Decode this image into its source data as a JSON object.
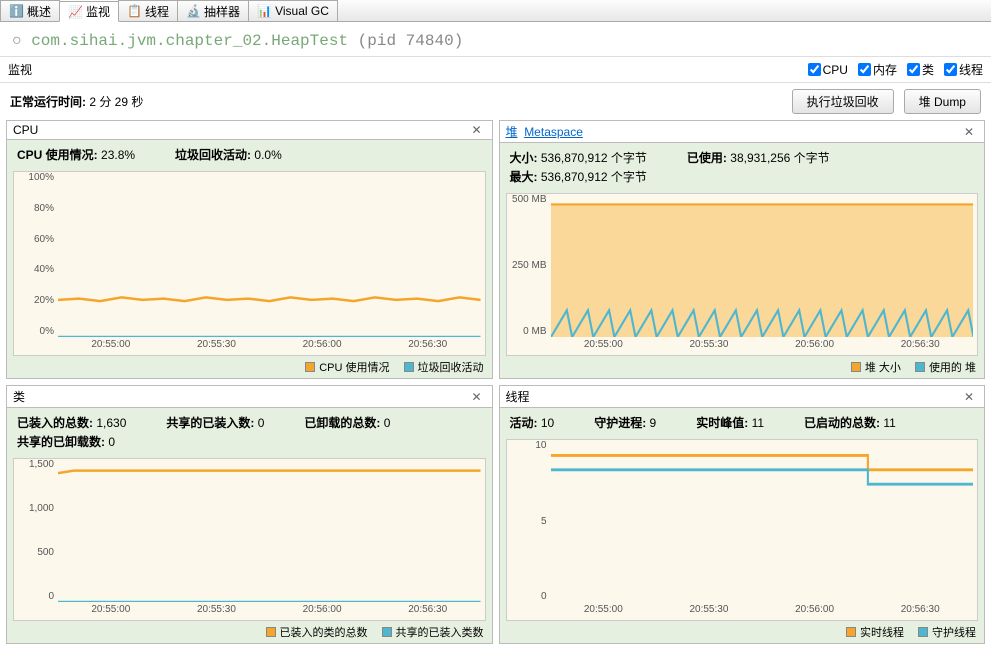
{
  "tabs": [
    "概述",
    "监视",
    "线程",
    "抽样器",
    "Visual GC"
  ],
  "active_tab": 1,
  "title_main": "com.sihai.jvm.chapter_02.HeapTest",
  "title_pid": "(pid 74840)",
  "sub_label": "监视",
  "checks": {
    "cpu": "CPU",
    "mem": "内存",
    "cls": "类",
    "thr": "线程"
  },
  "runtime_label": "正常运行时间:",
  "runtime_value": "2 分 29 秒",
  "btn_gc": "执行垃圾回收",
  "btn_dump": "堆 Dump",
  "cpu": {
    "title": "CPU",
    "usage_label": "CPU 使用情况:",
    "usage_val": "23.8%",
    "gc_label": "垃圾回收活动:",
    "gc_val": "0.0%",
    "legend": [
      "CPU 使用情况",
      "垃圾回收活动"
    ],
    "ylabels": [
      "100%",
      "80%",
      "60%",
      "40%",
      "20%",
      "0%"
    ],
    "xlabels": [
      "20:55:00",
      "20:55:30",
      "20:56:00",
      "20:56:30"
    ]
  },
  "heap": {
    "title_a": "堆",
    "title_b": "Metaspace",
    "size_label": "大小:",
    "size_val": "536,870,912 个字节",
    "max_label": "最大:",
    "max_val": "536,870,912 个字节",
    "used_label": "已使用:",
    "used_val": "38,931,256 个字节",
    "legend": [
      "堆 大小",
      "使用的 堆"
    ],
    "ylabels": [
      "500 MB",
      "250 MB",
      "0 MB"
    ],
    "xlabels": [
      "20:55:00",
      "20:55:30",
      "20:56:00",
      "20:56:30"
    ]
  },
  "classes": {
    "title": "类",
    "loaded_label": "已装入的总数:",
    "loaded_val": "1,630",
    "unloaded_label": "已卸载的总数:",
    "unloaded_val": "0",
    "shared_loaded_label": "共享的已装入数:",
    "shared_loaded_val": "0",
    "shared_unloaded_label": "共享的已卸载数:",
    "shared_unloaded_val": "0",
    "legend": [
      "已装入的类的总数",
      "共享的已装入类数"
    ],
    "ylabels": [
      "1,500",
      "1,000",
      "500",
      "0"
    ],
    "xlabels": [
      "20:55:00",
      "20:55:30",
      "20:56:00",
      "20:56:30"
    ]
  },
  "threads": {
    "title": "线程",
    "active_label": "活动:",
    "active_val": "10",
    "peak_label": "实时峰值:",
    "peak_val": "11",
    "daemon_label": "守护进程:",
    "daemon_val": "9",
    "started_label": "已启动的总数:",
    "started_val": "11",
    "legend": [
      "实时线程",
      "守护线程"
    ],
    "ylabels": [
      "10",
      "5",
      "0"
    ],
    "xlabels": [
      "20:55:00",
      "20:55:30",
      "20:56:00",
      "20:56:30"
    ]
  },
  "chart_data": [
    {
      "type": "line",
      "title": "CPU",
      "x": [
        "20:55:00",
        "20:55:30",
        "20:56:00",
        "20:56:30"
      ],
      "ylim": [
        0,
        100
      ],
      "series": [
        {
          "name": "CPU 使用情况",
          "values": [
            24,
            24,
            24,
            24
          ]
        },
        {
          "name": "垃圾回收活动",
          "values": [
            0,
            0,
            0,
            0
          ]
        }
      ]
    },
    {
      "type": "area",
      "title": "堆",
      "x": [
        "20:55:00",
        "20:55:30",
        "20:56:00",
        "20:56:30"
      ],
      "ylim": [
        0,
        536870912
      ],
      "series": [
        {
          "name": "堆 大小",
          "values": [
            536870912,
            536870912,
            536870912,
            536870912
          ]
        },
        {
          "name": "使用的 堆",
          "values_pattern": "sawtooth 0–90MB repeating",
          "sample": [
            10,
            90,
            10,
            90,
            10,
            90,
            10,
            90
          ]
        }
      ]
    },
    {
      "type": "line",
      "title": "类",
      "x": [
        "20:55:00",
        "20:55:30",
        "20:56:00",
        "20:56:30"
      ],
      "ylim": [
        0,
        1700
      ],
      "series": [
        {
          "name": "已装入的类的总数",
          "values": [
            1630,
            1630,
            1630,
            1630
          ]
        },
        {
          "name": "共享的已装入类数",
          "values": [
            0,
            0,
            0,
            0
          ]
        }
      ]
    },
    {
      "type": "line",
      "title": "线程",
      "x": [
        "20:55:00",
        "20:55:30",
        "20:56:00",
        "20:56:30"
      ],
      "ylim": [
        0,
        12
      ],
      "series": [
        {
          "name": "实时线程",
          "values": [
            11,
            11,
            11,
            10
          ]
        },
        {
          "name": "守护线程",
          "values": [
            10,
            10,
            10,
            9
          ]
        }
      ]
    }
  ],
  "colors": {
    "orange": "#f4a52a",
    "cyan": "#4fb6d0",
    "bg": "#fdf8ec",
    "panel": "#e6f0e0"
  }
}
